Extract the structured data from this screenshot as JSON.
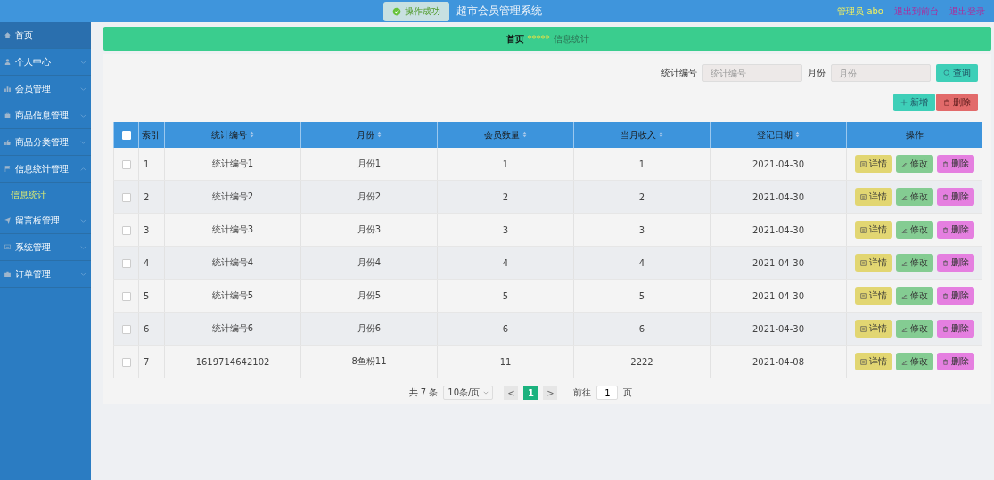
{
  "header": {
    "title": "超市会员管理系统",
    "user": "管理员 abo",
    "links": [
      "退出到前台",
      "退出登录"
    ]
  },
  "toast": {
    "text": "操作成功"
  },
  "sidebar": {
    "items": [
      {
        "label": "首页",
        "selected": true
      },
      {
        "label": "个人中心",
        "selected": false,
        "expanded": false
      },
      {
        "label": "会员管理",
        "selected": false,
        "expanded": false
      },
      {
        "label": "商品信息管理",
        "selected": false,
        "expanded": false
      },
      {
        "label": "商品分类管理",
        "selected": false,
        "expanded": false
      },
      {
        "label": "信息统计管理",
        "selected": false,
        "expanded": true,
        "children": [
          {
            "label": "信息统计",
            "selected": true
          }
        ]
      },
      {
        "label": "留言板管理",
        "selected": false,
        "expanded": false
      },
      {
        "label": "系统管理",
        "selected": false,
        "expanded": false
      },
      {
        "label": "订单管理",
        "selected": false,
        "expanded": false
      }
    ]
  },
  "breadcrumb": {
    "home": "首页",
    "separator": "*****",
    "current": "信息统计"
  },
  "search": {
    "fields": [
      {
        "label": "统计编号",
        "placeholder": "统计编号"
      },
      {
        "label": "月份",
        "placeholder": "月份"
      }
    ],
    "button": "查询"
  },
  "actions": {
    "add": "新增",
    "delete": "删除"
  },
  "table": {
    "select_all_checked": false,
    "columns": [
      {
        "label": "索引",
        "sortable": false
      },
      {
        "label": "统计编号",
        "sortable": true
      },
      {
        "label": "月份",
        "sortable": true
      },
      {
        "label": "会员数量",
        "sortable": true
      },
      {
        "label": "当月收入",
        "sortable": true
      },
      {
        "label": "登记日期",
        "sortable": true
      },
      {
        "label": "操作",
        "sortable": false
      }
    ],
    "rows": [
      {
        "checked": false,
        "cells": [
          "1",
          "统计编号1",
          "月份1",
          "1",
          "1",
          "2021-04-30"
        ],
        "buttons": [
          "详情",
          "修改",
          "删除"
        ]
      },
      {
        "checked": false,
        "cells": [
          "2",
          "统计编号2",
          "月份2",
          "2",
          "2",
          "2021-04-30"
        ],
        "buttons": [
          "详情",
          "修改",
          "删除"
        ]
      },
      {
        "checked": false,
        "cells": [
          "3",
          "统计编号3",
          "月份3",
          "3",
          "3",
          "2021-04-30"
        ],
        "buttons": [
          "详情",
          "修改",
          "删除"
        ]
      },
      {
        "checked": false,
        "cells": [
          "4",
          "统计编号4",
          "月份4",
          "4",
          "4",
          "2021-04-30"
        ],
        "buttons": [
          "详情",
          "修改",
          "删除"
        ]
      },
      {
        "checked": false,
        "cells": [
          "5",
          "统计编号5",
          "月份5",
          "5",
          "5",
          "2021-04-30"
        ],
        "buttons": [
          "详情",
          "修改",
          "删除"
        ]
      },
      {
        "checked": false,
        "cells": [
          "6",
          "统计编号6",
          "月份6",
          "6",
          "6",
          "2021-04-30"
        ],
        "buttons": [
          "详情",
          "修改",
          "删除"
        ]
      },
      {
        "checked": false,
        "cells": [
          "7",
          "1619714642102",
          "8鱼粉11",
          "11",
          "2222",
          "2021-04-08"
        ],
        "buttons": [
          "详情",
          "修改",
          "删除"
        ]
      }
    ]
  },
  "pagination": {
    "total": "共 7 条",
    "page_size": "10条/页",
    "prev": "<",
    "pages": [
      {
        "label": "1",
        "selected": true
      }
    ],
    "next": ">",
    "goto_label": "前往",
    "goto_value": "1",
    "goto_suffix": "页"
  }
}
